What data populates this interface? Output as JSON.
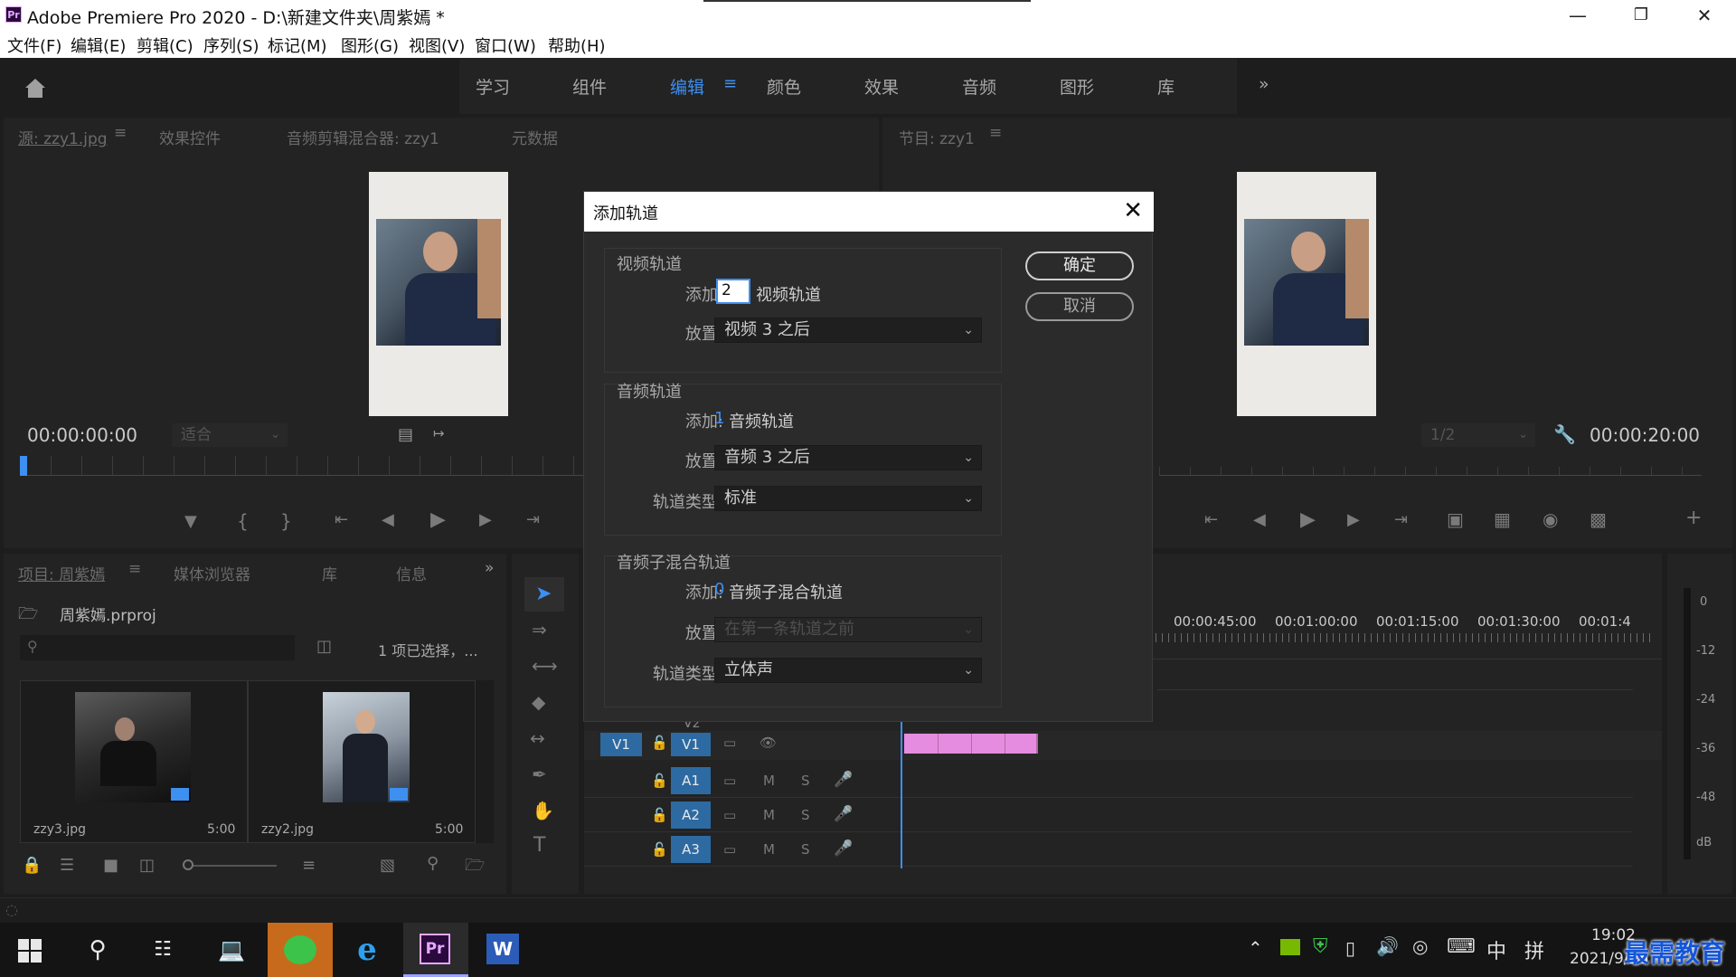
{
  "window": {
    "title": "Adobe Premiere Pro 2020 - D:\\新建文件夹\\周紫嫣 *",
    "logo_text": "Pr"
  },
  "menu": [
    "文件(F)",
    "编辑(E)",
    "剪辑(C)",
    "序列(S)",
    "标记(M)",
    "图形(G)",
    "视图(V)",
    "窗口(W)",
    "帮助(H)"
  ],
  "workspaces": {
    "tabs": [
      "学习",
      "组件",
      "编辑",
      "颜色",
      "效果",
      "音频",
      "图形",
      "库"
    ],
    "active": "编辑",
    "more": "»"
  },
  "source_panel": {
    "tabs": [
      "源: zzy1.jpg",
      "效果控件",
      "音频剪辑混合器: zzy1",
      "元数据"
    ],
    "timecode": "00:00:00:00",
    "fit": "适合"
  },
  "program_panel": {
    "tab": "节目: zzy1",
    "timecode": "00:00:20:00",
    "resolution": "1/2"
  },
  "project_panel": {
    "tabs": [
      "项目: 周紫嫣",
      "媒体浏览器",
      "库",
      "信息"
    ],
    "project_file": "周紫嫣.prproj",
    "selection": "1 项已选择，...",
    "items": [
      {
        "name": "zzy3.jpg",
        "duration": "5:00"
      },
      {
        "name": "zzy2.jpg",
        "duration": "5:00"
      }
    ]
  },
  "timeline": {
    "ruler": [
      "00:00:45:00",
      "00:01:00:00",
      "00:01:15:00",
      "00:01:30:00",
      "00:01:4"
    ],
    "tracks": {
      "video": [
        "V2",
        "V1"
      ],
      "source_patch": "V1",
      "audio": [
        "A1",
        "A2",
        "A3"
      ],
      "mute": "M",
      "solo": "S"
    },
    "meter": [
      "0",
      "-12",
      "-24",
      "-36",
      "-48",
      "dB"
    ]
  },
  "dialog": {
    "title": "添加轨道",
    "video": {
      "label": "视频轨道",
      "add_label": "添加:",
      "add_value": "2",
      "unit": "视频轨道",
      "place_label": "放置:",
      "place_value": "视频 3 之后"
    },
    "audio": {
      "label": "音频轨道",
      "add_label": "添加:",
      "add_value": "1",
      "unit": "音频轨道",
      "place_label": "放置:",
      "place_value": "音频 3 之后",
      "type_label": "轨道类型:",
      "type_value": "标准"
    },
    "submix": {
      "label": "音频子混合轨道",
      "add_label": "添加:",
      "add_value": "0",
      "unit": "音频子混合轨道",
      "place_label": "放置:",
      "place_value": "在第一条轨道之前",
      "type_label": "轨道类型:",
      "type_value": "立体声"
    },
    "ok": "确定",
    "cancel": "取消"
  },
  "taskbar": {
    "clock_time": "19:02",
    "clock_date": "2021/9/26",
    "ime": "中",
    "ime2": "拼",
    "watermark": "最需教育"
  },
  "colors": {
    "accent": "#3d8ff0",
    "clip": "#e58ce0",
    "track_button": "#2d6aa2"
  }
}
